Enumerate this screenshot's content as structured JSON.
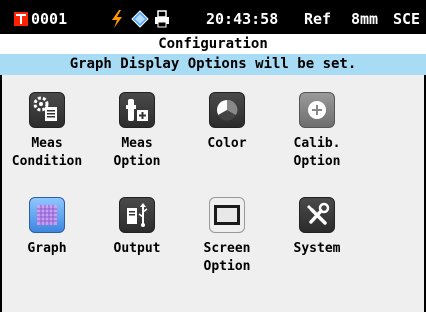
{
  "status": {
    "meas_number": "0001",
    "time": "20:43:58",
    "ref": "Ref",
    "aperture": "8mm",
    "mode": "SCE",
    "icons": [
      "target-icon",
      "battery-bolt-icon",
      "usb-diamond-icon",
      "printer-icon"
    ]
  },
  "title": "Configuration",
  "message": "Graph Display Options will be set.",
  "menu": {
    "items": [
      {
        "line1": "Meas",
        "line2": "Condition",
        "icon": "meas-condition-icon"
      },
      {
        "line1": "Meas",
        "line2": "Option",
        "icon": "meas-option-icon"
      },
      {
        "line1": "Color",
        "line2": "",
        "icon": "color-icon"
      },
      {
        "line1": "Calib.",
        "line2": "Option",
        "icon": "calib-option-icon"
      },
      {
        "line1": "Graph",
        "line2": "",
        "icon": "graph-icon",
        "selected": true
      },
      {
        "line1": "Output",
        "line2": "",
        "icon": "output-icon"
      },
      {
        "line1": "Screen",
        "line2": "Option",
        "icon": "screen-option-icon"
      },
      {
        "line1": "System",
        "line2": "",
        "icon": "system-icon"
      }
    ]
  },
  "colors": {
    "status_bg": "#000000",
    "message_bg": "#a8dcf4",
    "main_bg": "#efefef",
    "accent_red": "#ff2200",
    "bolt_color": "#ff9900",
    "diamond_color": "#4da6ff"
  }
}
